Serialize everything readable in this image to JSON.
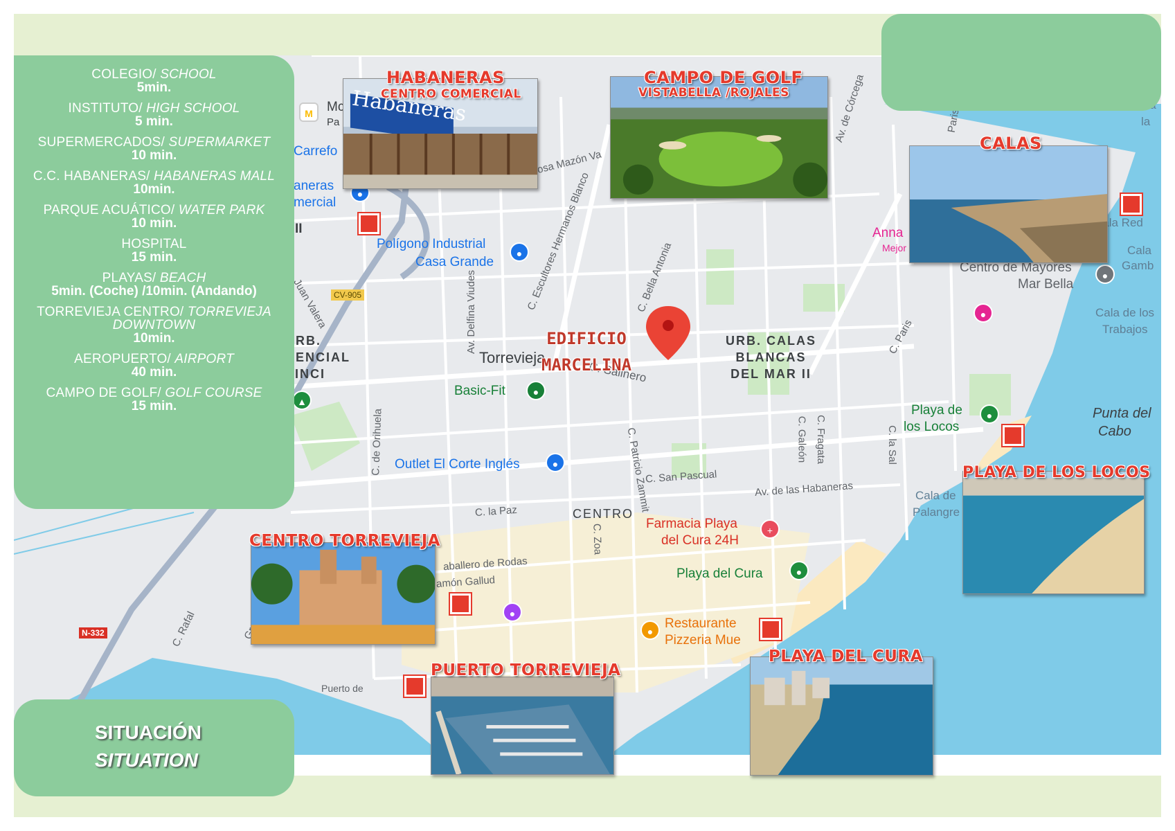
{
  "distances": [
    {
      "label": "COLEGIO/",
      "label_en": "SCHOOL",
      "time": "5min."
    },
    {
      "label": "INSTITUTO/",
      "label_en": "HIGH SCHOOL",
      "time": "5 min."
    },
    {
      "label": "SUPERMERCADOS/",
      "label_en": "SUPERMARKET",
      "time": "10 min."
    },
    {
      "label": "C.C. HABANERAS/",
      "label_en": "HABANERAS MALL",
      "time": "10min."
    },
    {
      "label": "PARQUE ACUÁTICO/",
      "label_en": "WATER PARK",
      "time": "10 min."
    },
    {
      "label": "HOSPITAL",
      "label_en": "",
      "time": "15 min."
    },
    {
      "label": "PLAYAS/",
      "label_en": "BEACH",
      "time": "5min. (Coche) /10min. (Andando)"
    },
    {
      "label": "TORREVIEJA CENTRO/",
      "label_en": "TORREVIEJA DOWNTOWN",
      "time": "10min."
    },
    {
      "label": "AEROPUERTO/",
      "label_en": "AIRPORT",
      "time": "40 min."
    },
    {
      "label": "CAMPO DE GOLF/",
      "label_en": "GOLF COURSE",
      "time": "15 min."
    }
  ],
  "situation": {
    "es": "SITUACIÓN",
    "en": "SITUATION"
  },
  "places": {
    "habaneras": {
      "title": "HABANERAS",
      "subtitle": "CENTRO COMERCIAL",
      "sign": "Habaneras"
    },
    "golf": {
      "title": "CAMPO DE GOLF",
      "subtitle": "VISTABELLA /ROJALES"
    },
    "calas": {
      "title": "CALAS"
    },
    "locos": {
      "title": "PLAYA DE LOS LOCOS"
    },
    "centro": {
      "title": "CENTRO TORREVIEJA"
    },
    "puerto": {
      "title": "PUERTO TORREVIEJA"
    },
    "cura": {
      "title": "PLAYA DEL CURA"
    }
  },
  "building": {
    "line1": "EDIFICIO",
    "line2": "MARCELINA"
  },
  "map_labels": {
    "torrevieja": "Torrevieja",
    "poligono1": "Polígono Industrial",
    "poligono2": "Casa Grande",
    "basicfit": "Basic-Fit",
    "outlet": "Outlet El Corte Inglés",
    "centro": "CENTRO",
    "farmacia1": "Farmacia Playa",
    "farmacia2": "del Cura 24H",
    "playacura": "Playa del Cura",
    "restaurante1": "Restaurante",
    "restaurante2": "Pizzeria Mue",
    "playalocos1": "Playa de",
    "playalocos2": "los Locos",
    "mayores1": "Centro de Mayores",
    "mayores2": "Mar Bella",
    "anna": "Anna",
    "mejor": "Mejor valorados",
    "calared": "Cala Red",
    "calagamb1": "Cala",
    "calagamb2": "Gamb",
    "trabajos1": "Cala de los",
    "trabajos2": "Trabajos",
    "palangre1": "Cala de",
    "palangre2": "Palangre",
    "punta1": "Punta del",
    "punta2": "Cabo",
    "urb1": "URB. CALAS",
    "urb2": "BLANCAS",
    "urb3": "DEL MAR II",
    "urbleft1": "URB.",
    "urbleft2": "DENCIAL",
    "urbleft3": "VINCI",
    "carrefour": "Carrefo",
    "habaneras_left1": "aneras",
    "habaneras_left2": "mercial",
    "mc": "Mc",
    "pa": "Pa",
    "ii": "II",
    "cv905": "CV-905",
    "n332": "N-332",
    "puertode": "Puerto de",
    "ca": "Ca",
    "la": "la",
    "road_rosa": "Av. Rosa Mazón Va",
    "road_corcega": "Av. de Córcega",
    "road_paris_top": "Paris",
    "road_escultores": "C. Escultores Hermanos Blanco",
    "road_bella": "C. Bella Antonia",
    "road_viudes": "Av. Delfina Viudes",
    "road_valera": "Juan Valera",
    "road_salinero": "C. Salinero",
    "road_paris": "C. Paris",
    "road_orihuela": "C. de Orihuela",
    "road_patricio": "C. Patricio Zammit",
    "road_galeon": "C. Galeón",
    "road_fragata": "C. Fragata",
    "road_sal": "C. la Sal",
    "road_pascual": "C. San Pascual",
    "road_habaneras": "Av. de las Habaneras",
    "road_paz": "C. la Paz",
    "road_zoa": "C. Zoa",
    "road_rodas": "aballero de Rodas",
    "road_gallud": "amón Gallud",
    "road_gregorio": "Gregorio M",
    "road_rafal": "C. Rafal"
  },
  "colors": {
    "panel_green": "#8ccc9c",
    "band_green": "#e6f0d2",
    "label_red": "#e53a2c",
    "sea": "#7fcbe8",
    "map_bg": "#e8eaed"
  }
}
